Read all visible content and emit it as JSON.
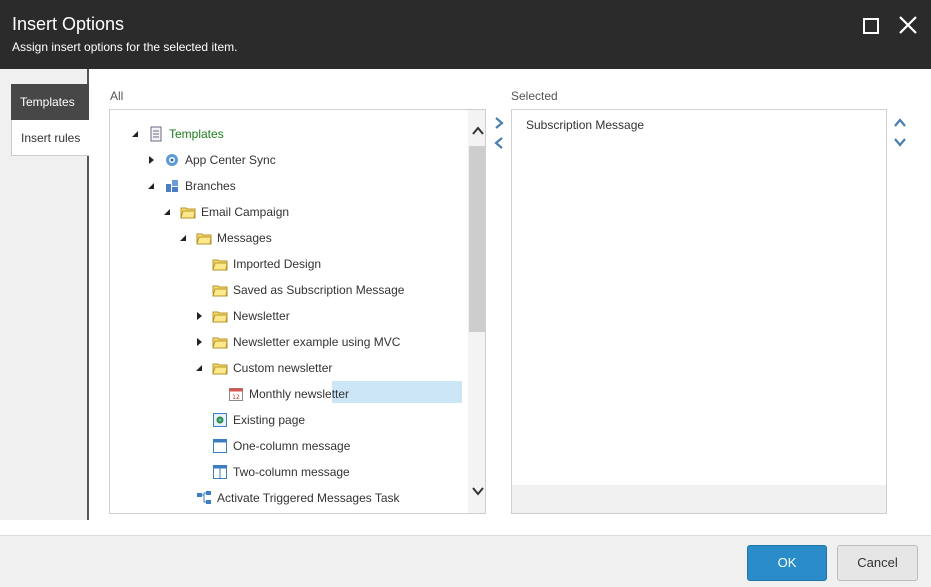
{
  "dialog": {
    "title": "Insert Options",
    "subtitle": "Assign insert options for the selected item."
  },
  "tabs": [
    {
      "label": "Templates",
      "active": true
    },
    {
      "label": "Insert rules",
      "active": false
    }
  ],
  "all_panel": {
    "label": "All",
    "tree": [
      {
        "label": "Templates",
        "expanded": true,
        "icon": "template-icon"
      },
      {
        "label": "App Center Sync",
        "expanded": false,
        "icon": "sync-icon"
      },
      {
        "label": "Branches",
        "expanded": true,
        "icon": "branch-icon"
      },
      {
        "label": "Email Campaign",
        "expanded": true,
        "icon": "folder-icon"
      },
      {
        "label": "Messages",
        "expanded": true,
        "icon": "folder-icon"
      },
      {
        "label": "Imported Design",
        "icon": "folder-icon"
      },
      {
        "label": "Saved as Subscription Message",
        "icon": "folder-icon"
      },
      {
        "label": "Newsletter",
        "expanded": false,
        "icon": "folder-icon"
      },
      {
        "label": "Newsletter example using MVC",
        "expanded": false,
        "icon": "folder-icon"
      },
      {
        "label": "Custom newsletter",
        "expanded": true,
        "icon": "folder-icon"
      },
      {
        "label": "Monthly newsletter",
        "selected": true,
        "icon": "calendar-icon"
      },
      {
        "label": "Existing page",
        "icon": "page-icon"
      },
      {
        "label": "One-column message",
        "icon": "one-column-icon"
      },
      {
        "label": "Two-column message",
        "icon": "two-column-icon"
      },
      {
        "label": "Activate Triggered Messages Task",
        "icon": "task-icon"
      }
    ]
  },
  "selected_panel": {
    "label": "Selected",
    "items": [
      "Subscription Message"
    ]
  },
  "buttons": {
    "ok": "OK",
    "cancel": "Cancel"
  },
  "colors": {
    "header_bg": "#2b2b2b",
    "accent": "#2a8dc9",
    "tree_root": "#1a7f1a",
    "selection": "#cde6f7",
    "arrow_blue": "#4a7fb0"
  }
}
